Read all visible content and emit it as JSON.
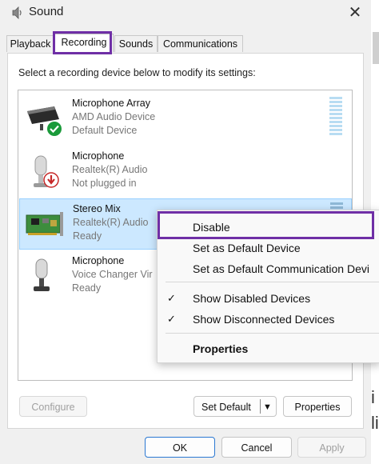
{
  "window": {
    "title": "Sound"
  },
  "tabs": [
    {
      "label": "Playback"
    },
    {
      "label": "Recording"
    },
    {
      "label": "Sounds"
    },
    {
      "label": "Communications"
    }
  ],
  "instruction": "Select a recording device below to modify its settings:",
  "devices": [
    {
      "name": "Microphone Array",
      "driver": "AMD Audio Device",
      "status": "Default Device",
      "icon": "microphone-array-icon"
    },
    {
      "name": "Microphone",
      "driver": "Realtek(R) Audio",
      "status": "Not plugged in",
      "icon": "microphone-icon"
    },
    {
      "name": "Stereo Mix",
      "driver": "Realtek(R) Audio",
      "status": "Ready",
      "icon": "sound-card-icon"
    },
    {
      "name": "Microphone",
      "driver": "Voice Changer Vir",
      "status": "Ready",
      "icon": "microphone-icon"
    }
  ],
  "buttons": {
    "configure": "Configure",
    "set_default": "Set Default",
    "properties": "Properties",
    "ok": "OK",
    "cancel": "Cancel",
    "apply": "Apply"
  },
  "context_menu": {
    "disable": "Disable",
    "set_default": "Set as Default Device",
    "set_default_comm": "Set as Default Communication Devi",
    "show_disabled": "Show Disabled Devices",
    "show_disconnected": "Show Disconnected Devices",
    "properties": "Properties"
  },
  "background": {
    "chars": [
      "i",
      "li"
    ]
  },
  "colors": {
    "highlight": "#6f2fa6",
    "selection": "#cce8ff",
    "default_check": "#1a9a3a",
    "unplugged": "#c62828"
  }
}
